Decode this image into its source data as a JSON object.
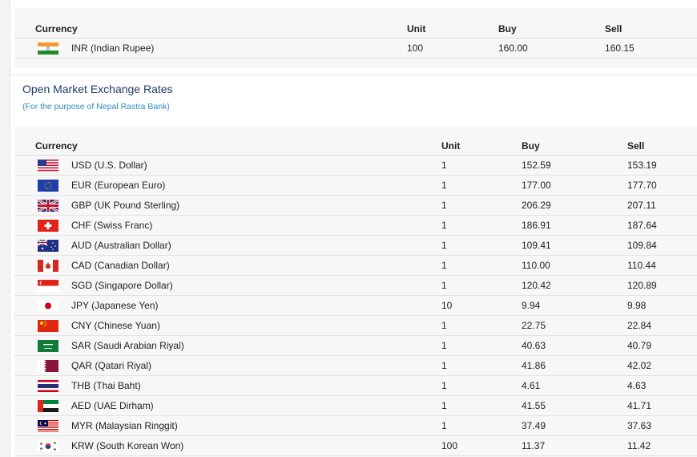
{
  "indian_rate": {
    "headers": {
      "currency": "Currency",
      "unit": "Unit",
      "buy": "Buy",
      "sell": "Sell"
    },
    "rows": [
      {
        "flag": "india-flag-icon",
        "name": "INR (Indian Rupee)",
        "unit": "100",
        "buy": "160.00",
        "sell": "160.15"
      }
    ]
  },
  "open_market": {
    "title": "Open Market Exchange Rates",
    "subtitle": "(For the purpose of Nepal Rastra Bank)",
    "headers": {
      "currency": "Currency",
      "unit": "Unit",
      "buy": "Buy",
      "sell": "Sell"
    },
    "rows": [
      {
        "flag": "usa-flag-icon",
        "name": "USD (U.S. Dollar)",
        "unit": "1",
        "buy": "152.59",
        "sell": "153.19"
      },
      {
        "flag": "eu-flag-icon",
        "name": "EUR (European Euro)",
        "unit": "1",
        "buy": "177.00",
        "sell": "177.70"
      },
      {
        "flag": "uk-flag-icon",
        "name": "GBP (UK Pound Sterling)",
        "unit": "1",
        "buy": "206.29",
        "sell": "207.11"
      },
      {
        "flag": "swiss-flag-icon",
        "name": "CHF (Swiss Franc)",
        "unit": "1",
        "buy": "186.91",
        "sell": "187.64"
      },
      {
        "flag": "australia-flag-icon",
        "name": "AUD (Australian Dollar)",
        "unit": "1",
        "buy": "109.41",
        "sell": "109.84"
      },
      {
        "flag": "canada-flag-icon",
        "name": "CAD (Canadian Dollar)",
        "unit": "1",
        "buy": "110.00",
        "sell": "110.44"
      },
      {
        "flag": "singapore-flag-icon",
        "name": "SGD (Singapore Dollar)",
        "unit": "1",
        "buy": "120.42",
        "sell": "120.89"
      },
      {
        "flag": "japan-flag-icon",
        "name": "JPY (Japanese Yen)",
        "unit": "10",
        "buy": "9.94",
        "sell": "9.98"
      },
      {
        "flag": "china-flag-icon",
        "name": "CNY (Chinese Yuan)",
        "unit": "1",
        "buy": "22.75",
        "sell": "22.84"
      },
      {
        "flag": "saudi-flag-icon",
        "name": "SAR (Saudi Arabian Riyal)",
        "unit": "1",
        "buy": "40.63",
        "sell": "40.79"
      },
      {
        "flag": "qatar-flag-icon",
        "name": "QAR (Qatari Riyal)",
        "unit": "1",
        "buy": "41.86",
        "sell": "42.02"
      },
      {
        "flag": "thailand-flag-icon",
        "name": "THB (Thai Baht)",
        "unit": "1",
        "buy": "4.61",
        "sell": "4.63"
      },
      {
        "flag": "uae-flag-icon",
        "name": "AED (UAE Dirham)",
        "unit": "1",
        "buy": "41.55",
        "sell": "41.71"
      },
      {
        "flag": "malaysia-flag-icon",
        "name": "MYR (Malaysian Ringgit)",
        "unit": "1",
        "buy": "37.49",
        "sell": "37.63"
      },
      {
        "flag": "korea-flag-icon",
        "name": "KRW (South Korean Won)",
        "unit": "100",
        "buy": "11.37",
        "sell": "11.42"
      }
    ]
  }
}
